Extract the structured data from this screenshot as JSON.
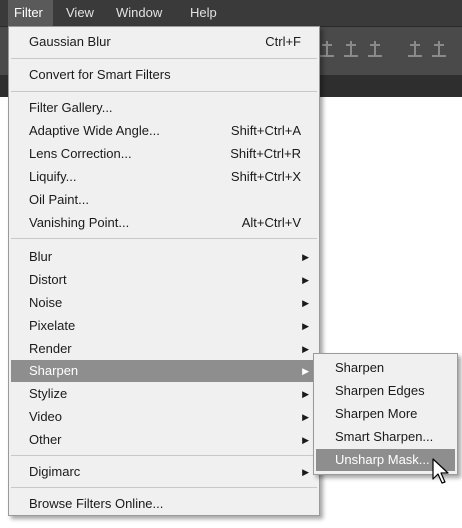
{
  "menubar": {
    "items": [
      "Filter",
      "View",
      "Window",
      "Help"
    ],
    "active": "Filter"
  },
  "filter_menu": {
    "items": [
      {
        "label": "Gaussian Blur",
        "shortcut": "Ctrl+F"
      },
      {
        "label": "Convert for Smart Filters"
      },
      {
        "label": "Filter Gallery..."
      },
      {
        "label": "Adaptive Wide Angle...",
        "shortcut": "Shift+Ctrl+A"
      },
      {
        "label": "Lens Correction...",
        "shortcut": "Shift+Ctrl+R"
      },
      {
        "label": "Liquify...",
        "shortcut": "Shift+Ctrl+X"
      },
      {
        "label": "Oil Paint..."
      },
      {
        "label": "Vanishing Point...",
        "shortcut": "Alt+Ctrl+V"
      },
      {
        "label": "Blur",
        "submenu": true
      },
      {
        "label": "Distort",
        "submenu": true
      },
      {
        "label": "Noise",
        "submenu": true
      },
      {
        "label": "Pixelate",
        "submenu": true
      },
      {
        "label": "Render",
        "submenu": true
      },
      {
        "label": "Sharpen",
        "submenu": true,
        "highlighted": true
      },
      {
        "label": "Stylize",
        "submenu": true
      },
      {
        "label": "Video",
        "submenu": true
      },
      {
        "label": "Other",
        "submenu": true
      },
      {
        "label": "Digimarc",
        "submenu": true
      },
      {
        "label": "Browse Filters Online..."
      }
    ]
  },
  "sharpen_submenu": {
    "items": [
      {
        "label": "Sharpen"
      },
      {
        "label": "Sharpen Edges"
      },
      {
        "label": "Sharpen More"
      },
      {
        "label": "Smart Sharpen..."
      },
      {
        "label": "Unsharp Mask...",
        "highlighted": true
      }
    ]
  },
  "icons": {
    "submenu_arrow": "chevron-right-icon",
    "cursor": "mouse-pointer-icon",
    "align": "align-icon"
  },
  "colors": {
    "menubar_bg": "#3a3a3a",
    "menu_bg": "#f0f0f0",
    "highlight_bg": "#8e8e8e",
    "highlight_text": "#ffffff"
  }
}
